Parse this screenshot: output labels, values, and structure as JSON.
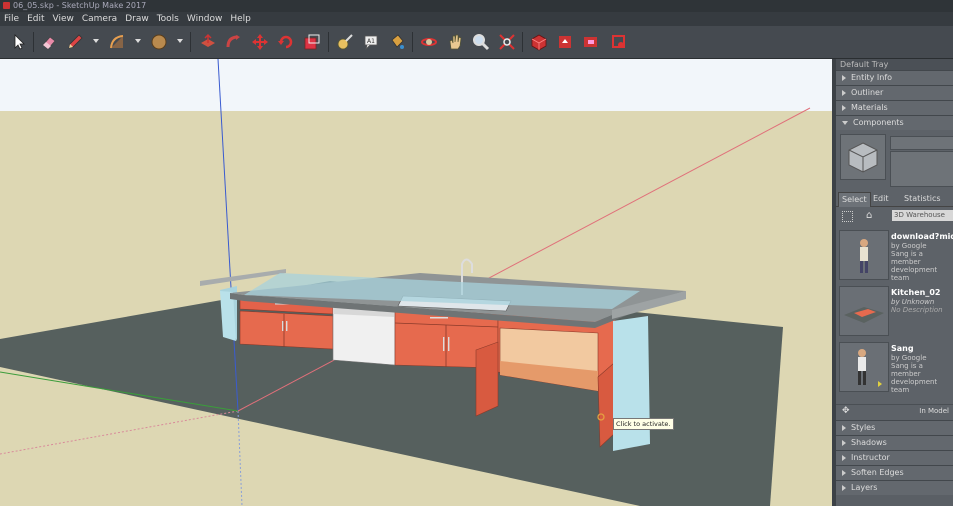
{
  "window": {
    "title": "06_05.skp - SketchUp Make 2017"
  },
  "menu": [
    "File",
    "Edit",
    "View",
    "Camera",
    "Draw",
    "Tools",
    "Window",
    "Help"
  ],
  "toolbar": {
    "tools": [
      "select-icon",
      "eraser-icon",
      "pencil-icon",
      "arc-icon",
      "circle-icon",
      "push-pull-icon",
      "follow-me-icon",
      "move-icon",
      "rotate-icon",
      "offset-icon",
      "tape-measure-icon",
      "text-icon",
      "paint-bucket-icon",
      "orbit-icon",
      "pan-icon",
      "zoom-icon",
      "zoom-extents-icon",
      "warehouse-icon",
      "share-model-icon",
      "extension-icon",
      "add-location-icon"
    ]
  },
  "viewport": {
    "tooltip": "Click to activate.",
    "colors": {
      "sky": "#f2f6fa",
      "ground": "#ddd7b3",
      "slab": "#56605e",
      "cabinet": "#e66a4e",
      "counter": "#8f9495",
      "wall": "#b9e1ea"
    }
  },
  "tray": {
    "title": "Default Tray",
    "panels_top": [
      "Entity Info",
      "Outliner",
      "Materials",
      "Components"
    ],
    "components": {
      "tabs": [
        "Select",
        "Edit",
        "Statistics"
      ],
      "search_value": "3D Warehouse",
      "items": [
        {
          "name": "download?mid",
          "by": "by Google",
          "desc": "Sang is a member development team",
          "italic": false
        },
        {
          "name": "Kitchen_02",
          "by": "by Unknown",
          "desc": "No Description",
          "italic": true
        },
        {
          "name": "Sang",
          "by": "by Google",
          "desc": "Sang is a member development team",
          "italic": false
        }
      ],
      "footer": "In Model"
    },
    "panels_bottom": [
      "Styles",
      "Shadows",
      "Instructor",
      "Soften Edges",
      "Layers"
    ]
  }
}
